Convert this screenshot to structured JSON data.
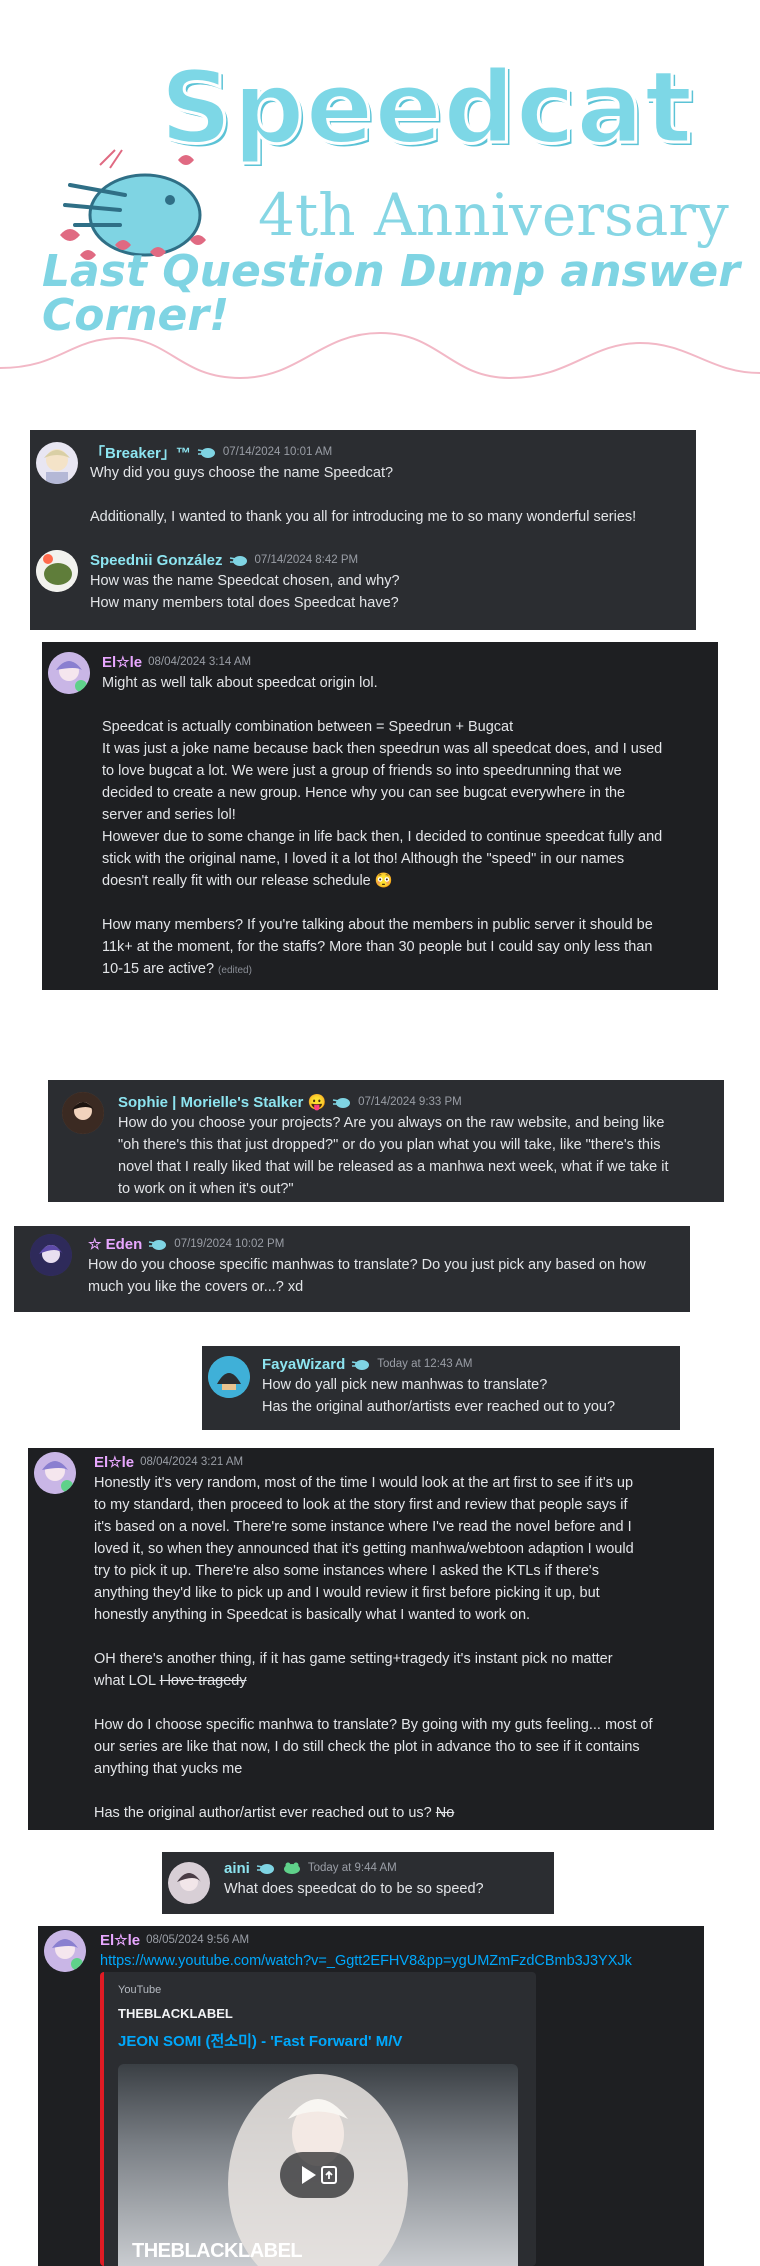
{
  "header": {
    "title": "Speedcat",
    "subtitle": "4th Anniversary",
    "tagline": "Last Question Dump answer Corner!"
  },
  "colors": {
    "brand": "#7dd7e6",
    "discord_bg": "#2b2d31",
    "discord_dark": "#1e1f22",
    "link": "#00a8fc",
    "youtube_red": "#e01b24"
  },
  "block1": {
    "msg1": {
      "username": "「Breaker」™",
      "timestamp": "07/14/2024 10:01 AM",
      "lines": [
        "Why did you guys choose the name Speedcat?",
        "",
        "Additionally, I wanted to thank you all for introducing me to so many wonderful series!"
      ]
    },
    "msg2": {
      "username": "Speednii González",
      "timestamp": "07/14/2024 8:42 PM",
      "lines": [
        "How was the name Speedcat chosen, and why?",
        "How many members total does Speedcat have?"
      ]
    }
  },
  "answer1": {
    "username": "El☆le",
    "timestamp": "08/04/2024 3:14 AM",
    "lines": [
      "Might as well talk about speedcat origin lol.",
      "",
      "Speedcat is actually combination between = Speedrun + Bugcat",
      "It was just a joke name because back then speedrun was all speedcat does, and I used",
      "to love bugcat a lot. We were just a group of friends so into speedrunning that we",
      "decided to create a new group. Hence why you can see bugcat everywhere in the",
      "server and series lol!",
      "However due to some change in life back then, I decided to continue speedcat fully and",
      "stick with the original name, I loved it a lot tho! Although the \"speed\" in our names",
      "doesn't really fit with our release schedule 😳",
      "",
      "How many members? If you're talking about the members in public server it should be",
      "11k+ at the moment, for the staffs? More than 30 people but I could say only less than",
      "10-15 are active?"
    ],
    "edited": "(edited)"
  },
  "q_sophie": {
    "username": "Sophie | Morielle's Stalker 😛",
    "timestamp": "07/14/2024 9:33 PM",
    "lines": [
      "How do you choose your projects? Are you always on the raw website, and being like",
      "\"oh there's this that just dropped?\" or do you plan what you will take, like \"there's this",
      "novel that I really liked that will be released as a manhwa next week, what if we take it",
      "to work on it when it's out?\""
    ]
  },
  "q_eden": {
    "username": "☆ Eden",
    "timestamp": "07/19/2024 10:02 PM",
    "lines": [
      "How do you choose specific manhwas to translate? Do you just pick any based on how",
      "much you like the covers or...? xd"
    ]
  },
  "q_faya": {
    "username": "FayaWizard",
    "timestamp": "Today at 12:43 AM",
    "lines": [
      "How do yall pick new manhwas to translate?",
      "Has the original author/artists ever reached out to you?"
    ]
  },
  "answer2": {
    "username": "El☆le",
    "timestamp": "08/04/2024 3:21 AM",
    "lines": [
      "Honestly it's very random, most of the time I would look at the art first to see if it's up",
      "to my standard, then proceed to look at the story first and review that people says if",
      "it's based on a novel. There're some instance where I've read the novel before and I",
      "loved it, so when they announced that it's getting manhwa/webtoon adaption I would",
      "try to pick it up. There're also some instances where I asked the KTLs if there's",
      "anything they'd like to pick up and I would review it first before picking it up, but",
      "honestly anything in Speedcat is basically what I wanted to work on.",
      "",
      "OH there's another thing, if it has game setting+tragedy it's instant pick no matter"
    ],
    "what_lol": "what LOL ",
    "strike1": "I love tragedy",
    "lines2": [
      "",
      "How do I choose specific manhwa to translate? By going with my guts feeling... most of",
      "our series are like that now, I do still check the plot in advance tho to see if it contains",
      "anything that yucks me",
      ""
    ],
    "last_line": "Has the original author/artist ever reached out to us? ",
    "strike2": "No"
  },
  "q_aini": {
    "username": "aini",
    "timestamp": "Today at 9:44 AM",
    "text": "What does speedcat do to be so speed?"
  },
  "answer3": {
    "username": "El☆le",
    "timestamp": "08/05/2024 9:56 AM",
    "link": "https://www.youtube.com/watch?v=_Ggtt2EFHV8&pp=ygUMZmFzdCBmb3J3YXJk",
    "embed": {
      "provider": "YouTube",
      "author": "THEBLACKLABEL",
      "title": "JEON SOMI (전소미) - 'Fast Forward' M/V",
      "watermark": "THEBLACKLABEL"
    }
  }
}
